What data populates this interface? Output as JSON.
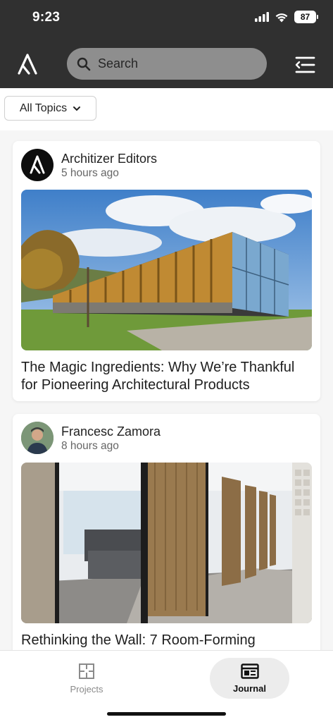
{
  "status_bar": {
    "time": "9:23",
    "battery": "87"
  },
  "header": {
    "search_placeholder": "Search"
  },
  "filter": {
    "label": "All Topics"
  },
  "posts": [
    {
      "author": "Architizer Editors",
      "time_ago": "5 hours ago",
      "title": "The Magic Ingredients: Why We’re Thankful for Pioneering Architectural Products"
    },
    {
      "author": "Francesc Zamora",
      "time_ago": "8 hours ago",
      "title": "Rethinking the Wall: 7 Room-Forming"
    }
  ],
  "tabs": [
    {
      "label": "Projects"
    },
    {
      "label": "Journal"
    }
  ],
  "colors": {
    "header_bg": "#303030",
    "search_bg": "#8e8e8e",
    "active_tab_bg": "#ececec"
  }
}
